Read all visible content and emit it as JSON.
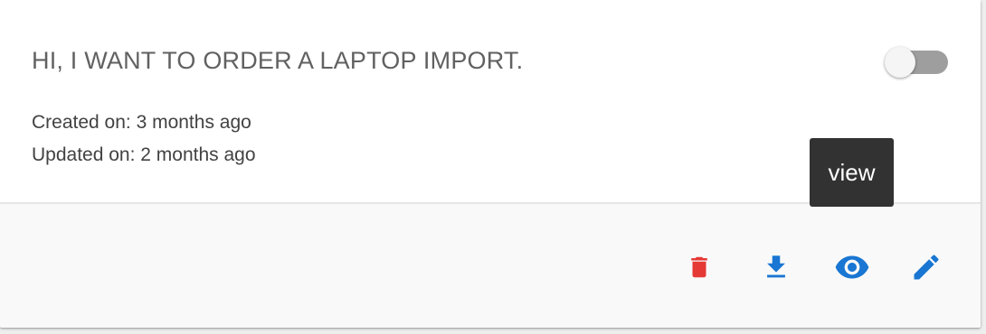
{
  "card": {
    "title": "HI, I WANT TO ORDER A LAPTOP IMPORT.",
    "created": "Created on: 3 months ago",
    "updated": "Updated on: 2 months ago",
    "toggle": {
      "state": "off"
    }
  },
  "actions": {
    "delete": {
      "icon": "trash-icon",
      "color": "#e53935"
    },
    "download": {
      "icon": "download-icon",
      "color": "#1976d2"
    },
    "view": {
      "icon": "eye-icon",
      "color": "#1976d2"
    },
    "edit": {
      "icon": "pencil-icon",
      "color": "#1976d2"
    }
  },
  "tooltip": {
    "text": "view"
  }
}
